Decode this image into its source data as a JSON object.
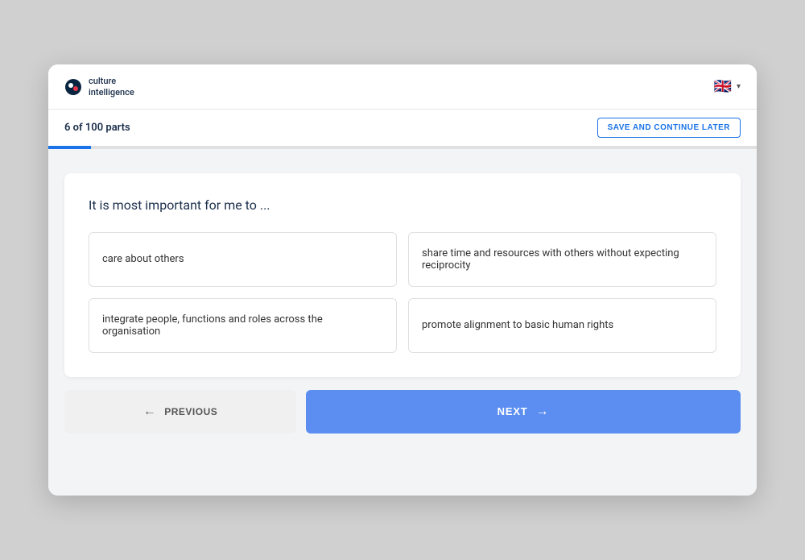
{
  "header": {
    "logo_line1": "culture",
    "logo_line2": "intelligence",
    "lang_flag": "🇬🇧",
    "chevron": "▾"
  },
  "progress": {
    "label": "6 of 100 parts",
    "save_label": "SAVE AND CONTINUE LATER",
    "fill_percent": "6%"
  },
  "question": {
    "text": "It is most important for me to ..."
  },
  "options": [
    {
      "text": "care about others"
    },
    {
      "text": "share time and resources with others without expecting reciprocity"
    },
    {
      "text": "integrate people, functions and roles across the organisation"
    },
    {
      "text": "promote alignment to basic human rights"
    }
  ],
  "navigation": {
    "previous_label": "PREVIOUS",
    "next_label": "NEXT"
  }
}
